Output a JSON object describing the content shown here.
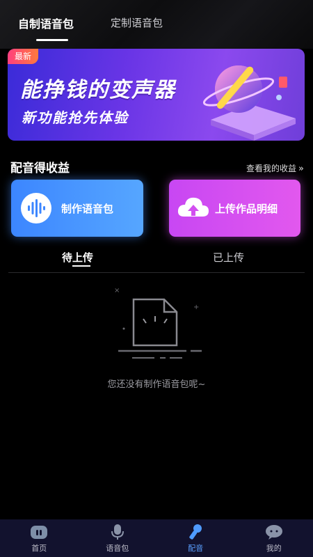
{
  "top_tabs": {
    "active": "自制语音包",
    "inactive": "定制语音包"
  },
  "banner": {
    "tag": "最新",
    "title": "能挣钱的变声器",
    "subtitle": "新功能抢先体验"
  },
  "section": {
    "title": "配音得收益",
    "link": "查看我的收益",
    "link_icon": "double-chevron-right-icon"
  },
  "actions": {
    "make": {
      "label": "制作语音包",
      "icon": "waveform-icon",
      "color": "#3c86ff"
    },
    "upload": {
      "label": "上传作品明细",
      "icon": "cloud-upload-icon",
      "color": "#d24ff0"
    }
  },
  "sub_tabs": {
    "active": "待上传",
    "inactive": "已上传"
  },
  "empty": {
    "message": "您还没有制作语音包呢~",
    "icon": "empty-document-icon"
  },
  "nav": [
    {
      "label": "首页",
      "icon": "home-icon",
      "active": false
    },
    {
      "label": "语音包",
      "icon": "microphone-icon",
      "active": false
    },
    {
      "label": "配音",
      "icon": "dub-microphone-icon",
      "active": true
    },
    {
      "label": "我的",
      "icon": "chat-bubble-icon",
      "active": false
    }
  ],
  "colors": {
    "background": "#000000",
    "nav_background": "#12122e",
    "accent_blue": "#5aa0ff"
  }
}
